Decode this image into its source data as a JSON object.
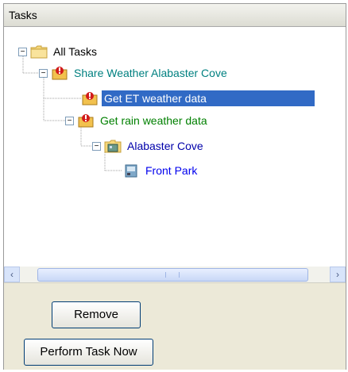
{
  "panel": {
    "title": "Tasks"
  },
  "tree": {
    "items": [
      {
        "label": "All Tasks",
        "color": "#000000",
        "expander": "−",
        "icon": "folder-icon"
      },
      {
        "label": "Share Weather Alabaster Cove",
        "color": "#008080",
        "expander": "−",
        "icon": "task-warning-icon"
      },
      {
        "label": "Get ET weather data",
        "color": "#ffffff",
        "selected": true,
        "icon": "task-warning-icon"
      },
      {
        "label": "Get rain weather data",
        "color": "#008000",
        "expander": "−",
        "icon": "task-warning-icon"
      },
      {
        "label": "Alabaster Cove",
        "color": "#0000aa",
        "expander": "−",
        "icon": "site-icon"
      },
      {
        "label": "Front Park",
        "color": "#0000ee",
        "icon": "controller-icon"
      }
    ]
  },
  "scrollbar": {
    "left_arrow": "‹",
    "right_arrow": "›"
  },
  "buttons": {
    "remove": "Remove",
    "perform": "Perform Task Now"
  }
}
